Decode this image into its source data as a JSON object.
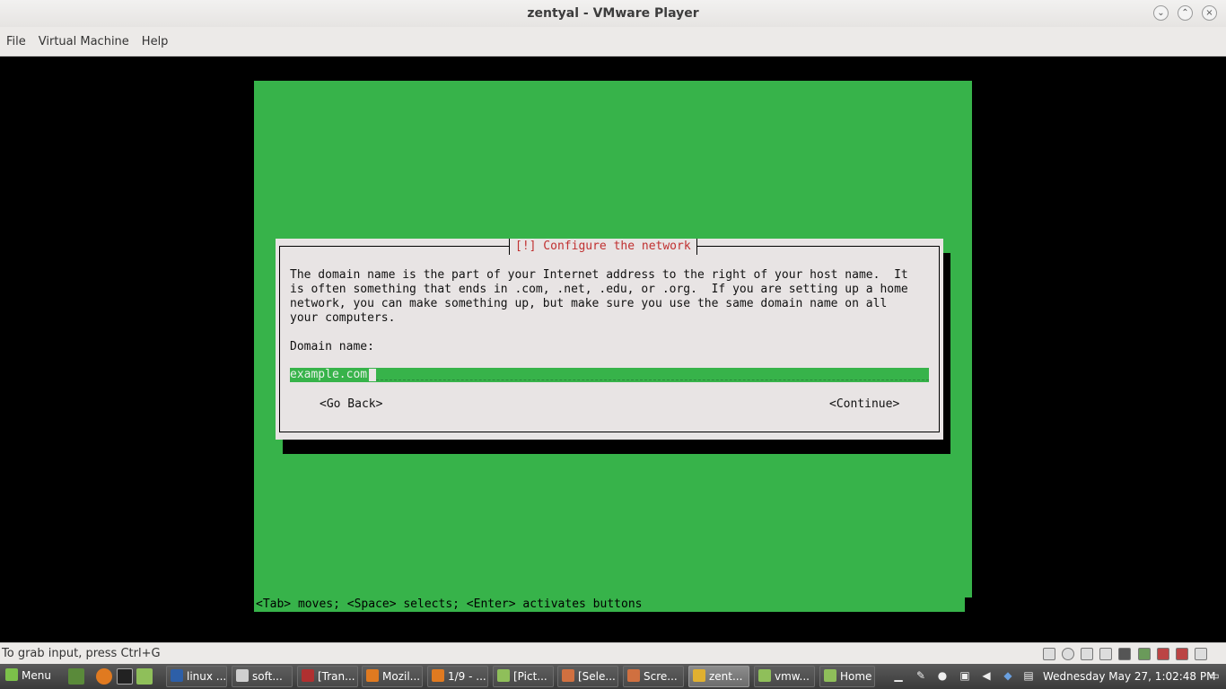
{
  "window": {
    "title": "zentyal - VMware Player",
    "minimize_glyph": "⌄",
    "maximize_glyph": "⌃",
    "close_glyph": "×"
  },
  "menubar": {
    "items": [
      "File",
      "Virtual Machine",
      "Help"
    ]
  },
  "installer": {
    "dialog_title": "[!] Configure the network",
    "body": "The domain name is the part of your Internet address to the right of your host name.  It\nis often something that ends in .com, .net, .edu, or .org.  If you are setting up a home\nnetwork, you can make something up, but make sure you use the same domain name on all\nyour computers.",
    "field_label": "Domain name:",
    "field_value": "example.com",
    "go_back": "<Go Back>",
    "continue": "<Continue>",
    "hint": "<Tab> moves; <Space> selects; <Enter> activates buttons"
  },
  "statusbar": {
    "text": "To grab input, press Ctrl+G"
  },
  "taskbar": {
    "menu_label": "Menu",
    "windows": [
      {
        "label": "linux ...",
        "color": "#2d5fa8",
        "active": false
      },
      {
        "label": "soft...",
        "color": "#cfcfcf",
        "active": false
      },
      {
        "label": "[Tran...",
        "color": "#b03030",
        "active": false
      },
      {
        "label": "Mozil...",
        "color": "#e07a20",
        "active": false
      },
      {
        "label": "1/9 - ...",
        "color": "#e07a20",
        "active": false
      },
      {
        "label": "[Pict...",
        "color": "#8fbf5a",
        "active": false
      },
      {
        "label": "[Sele...",
        "color": "#d07040",
        "active": false
      },
      {
        "label": "Scre...",
        "color": "#d07040",
        "active": false
      },
      {
        "label": "zent...",
        "color": "#e0b030",
        "active": true
      },
      {
        "label": "vmw...",
        "color": "#8fbf5a",
        "active": false
      },
      {
        "label": "Home",
        "color": "#8fbf5a",
        "active": false
      }
    ],
    "clock": "Wednesday May 27,  1:02:48 PM"
  }
}
